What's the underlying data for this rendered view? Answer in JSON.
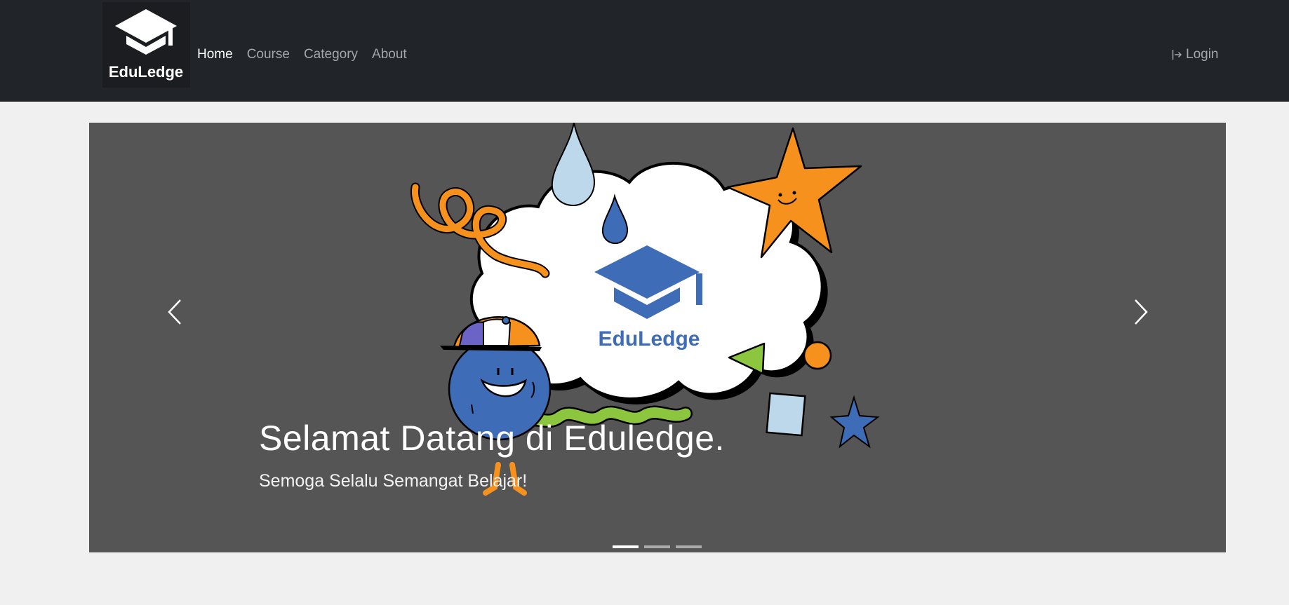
{
  "brand": {
    "name": "EduLedge",
    "logo_icon": "graduation-cap-icon"
  },
  "nav": {
    "items": [
      {
        "label": "Home",
        "active": true
      },
      {
        "label": "Course",
        "active": false
      },
      {
        "label": "Category",
        "active": false
      },
      {
        "label": "About",
        "active": false
      }
    ],
    "login_label": "Login",
    "login_icon": "login-arrow-icon"
  },
  "carousel": {
    "slide_logo_text": "EduLedge",
    "caption_title": "Selamat Datang di Eduledge.",
    "caption_subtitle": "Semoga Selalu Semangat Belajar!",
    "prev_icon": "chevron-left-icon",
    "next_icon": "chevron-right-icon",
    "slide_count": 3,
    "active_slide": 1
  },
  "colors": {
    "navbar": "#212529",
    "page_bg": "#f0f0f0",
    "carousel_bg": "#555555",
    "brand_blue": "#3f6cb6",
    "accent_orange": "#f7911e",
    "accent_green": "#8cc63f",
    "light_blue": "#bcd8ea"
  }
}
